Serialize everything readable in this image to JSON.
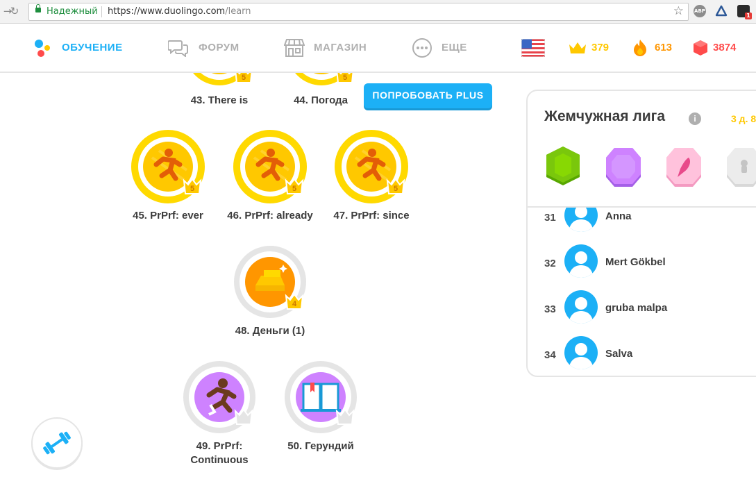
{
  "browser": {
    "secure_label": "Надежный",
    "url_host": "https://www.duolingo.com",
    "url_path": "/learn",
    "ext_badge": "1"
  },
  "nav": {
    "learn": "ОБУЧЕНИЕ",
    "forum": "ФОРУМ",
    "shop": "МАГАЗИН",
    "more": "ЕЩЕ"
  },
  "stats": {
    "crowns": "379",
    "streak": "613",
    "gems": "3874"
  },
  "plus_button": "ПОПРОБОВАТЬ PLUS",
  "skills": [
    {
      "label": "43. There is",
      "crown": "5"
    },
    {
      "label": "44. Погода",
      "crown": "5"
    },
    {
      "label": "45. PrPrf: ever",
      "crown": "5"
    },
    {
      "label": "46. PrPrf: already",
      "crown": "5"
    },
    {
      "label": "47. PrPrf: since",
      "crown": "5"
    },
    {
      "label": "48. Деньги (1)",
      "crown": "4"
    },
    {
      "label_line1": "49. PrPrf:",
      "label_line2": "Continuous",
      "crown": ""
    },
    {
      "label": "50. Герундий",
      "crown": ""
    }
  ],
  "league": {
    "title": "Жемчужная лига",
    "info": "i",
    "days_left": "3 д. 8",
    "rows": [
      {
        "rank": "31",
        "name": "Anna"
      },
      {
        "rank": "32",
        "name": "Mert Gökbel"
      },
      {
        "rank": "33",
        "name": "gruba malpa"
      },
      {
        "rank": "34",
        "name": "Salva"
      }
    ]
  },
  "colors": {
    "accent": "#1cb0f6",
    "gold": "#ffc800",
    "streak": "#ff9600",
    "gems": "#ff4b4b"
  }
}
